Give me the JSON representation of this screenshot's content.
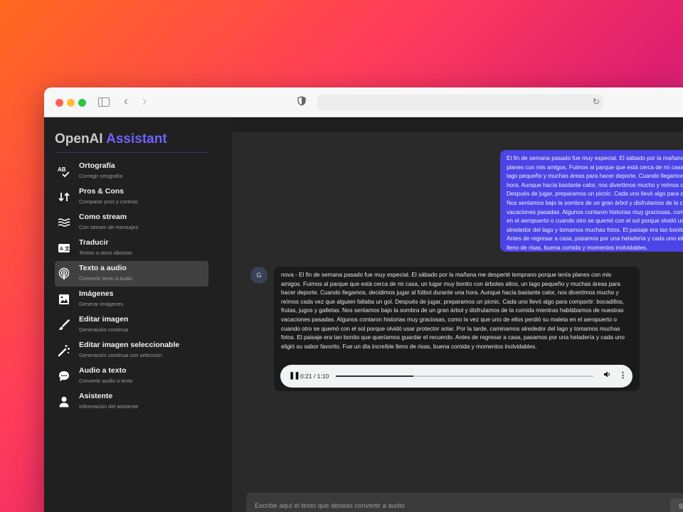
{
  "sidebar": {
    "brand_primary": "OpenAI",
    "brand_accent": "Assistant",
    "items": [
      {
        "title": "Ortografía",
        "subtitle": "Corregir ortografía",
        "icon": "spellcheck-icon"
      },
      {
        "title": "Pros & Cons",
        "subtitle": "Comparar pros y contras",
        "icon": "compare-arrows-icon"
      },
      {
        "title": "Como stream",
        "subtitle": "Con stream de mensajes",
        "icon": "waves-icon"
      },
      {
        "title": "Traducir",
        "subtitle": "Textos a otros idiomas",
        "icon": "translate-icon"
      },
      {
        "title": "Texto a audio",
        "subtitle": "Convertir texto a audio",
        "icon": "podcast-icon",
        "active": true
      },
      {
        "title": "Imágenes",
        "subtitle": "Generar imágenes",
        "icon": "image-icon"
      },
      {
        "title": "Editar imagen",
        "subtitle": "Generación continua",
        "icon": "brush-icon"
      },
      {
        "title": "Editar imagen seleccionable",
        "subtitle": "Generación continua con selección",
        "icon": "magic-wand-icon"
      },
      {
        "title": "Audio a texto",
        "subtitle": "Convertir audio a texto",
        "icon": "chat-bubble-icon"
      },
      {
        "title": "Asistente",
        "subtitle": "Información del asistente",
        "icon": "person-icon"
      }
    ]
  },
  "chat": {
    "user_lines": [
      "El fin de semana pasado fue muy especial. El sábado por la mañana me desperté",
      "planes con mis amigos. Fuimos al parque que está cerca de mi casa, un lugar",
      "lago pequeño y muchas áreas para hacer deporte. Cuando llegamos, decidimos jugar",
      "hora. Aunque hacía bastante calor, nos divertimos mucho y reímos cada vez que",
      "Después de jugar, preparamos un picnic. Cada uno llevó algo para compartir:",
      "Nos sentamos bajo la sombra de un gran árbol y disfrutamos de la comida mientras",
      "vacaciones pasadas. Algunos contaron historias muy graciosas, como la vez que",
      "en el aeropuerto o cuando otro se quemó con el sol porque olvidó usar protector",
      "alrededor del lago y tomamos muchas fotos. El paisaje era tan bonito que todos",
      "Antes de regresar a casa, pasamos por una heladería y cada uno eligió su sabor",
      "lleno de risas, buena comida y momentos inolvidables."
    ],
    "bot_avatar": "G",
    "bot_text": "nova - El fin de semana pasado fue muy especial. El sábado por la mañana me desperté temprano porque tenía planes con mis amigos. Fuimos al parque que está cerca de mi casa, un lugar muy bonito con árboles altos, un lago pequeño y muchas áreas para hacer deporte. Cuando llegamos, decidimos jugar al fútbol durante una hora. Aunque hacía bastante calor, nos divertimos mucho y reímos cada vez que alguien fallaba un gol. Después de jugar, preparamos un picnic. Cada uno llevó algo para compartir: bocadillos, frutas, jugos y galletas. Nos sentamos bajo la sombra de un gran árbol y disfrutamos de la comida mientras hablábamos de nuestras vacaciones pasadas. Algunos contaron historias muy graciosas, como la vez que uno de ellos perdió su maleta en el aeropuerto o cuando otro se quemó con el sol porque olvidó usar protector solar. Por la tarde, caminamos alrededor del lago y tomamos muchas fotos. El paisaje era tan bonito que queríamos guardar el recuerdo. Antes de regresar a casa, pasamos por una heladería y cada uno eligió su sabor favorito. Fue un día increíble lleno de risas, buena comida y momentos inolvidables.",
    "audio": {
      "time": "0:21 / 1:10",
      "progress": 0.3
    }
  },
  "input": {
    "placeholder": "Escribe aquí el texto que deseas convertir a audio",
    "send_label": "S"
  },
  "colors": {
    "accent": "#6c63ff",
    "user_bubble": "#4b44e6",
    "background_gradient_start": "#ff6a1f",
    "background_gradient_end": "#8a2bd1"
  }
}
